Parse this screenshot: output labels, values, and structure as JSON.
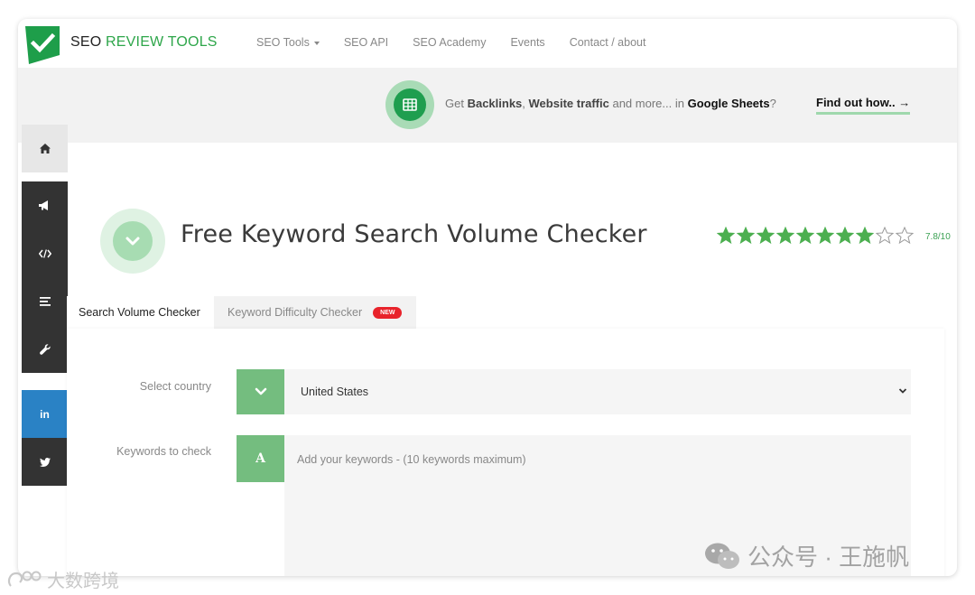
{
  "brand": {
    "name_prefix": "SEO",
    "name_suffix": "REVIEW TOOLS"
  },
  "nav": {
    "items": [
      "SEO Tools",
      "SEO API",
      "SEO Academy",
      "Events",
      "Contact / about"
    ]
  },
  "banner": {
    "text_1": "Get ",
    "bold_1": "Backlinks",
    "text_2": ", ",
    "bold_2": "Website traffic",
    "text_3": " and more... in ",
    "bold_3": "Google Sheets",
    "text_4": "?",
    "cta": "Find out how.. →"
  },
  "sidebar": {
    "icons": [
      "home-icon",
      "megaphone-icon",
      "code-icon",
      "list-icon",
      "wrench-icon",
      "linkedin-icon",
      "twitter-icon"
    ],
    "linkedin_label": "in",
    "colors": {
      "home_bg": "#e7e7e7",
      "dark_bg": "#333333",
      "linkedin_bg": "#2a82c5",
      "twitter_bg": "#333333"
    }
  },
  "page": {
    "title": "Free Keyword Search Volume Checker",
    "rating": {
      "filled_stars": 8,
      "total_stars": 10,
      "label": "7.8/10"
    }
  },
  "tabs": [
    {
      "label": "Search Volume Checker",
      "active": true
    },
    {
      "label": "Keyword Difficulty Checker",
      "active": false,
      "badge": "NEW"
    }
  ],
  "form": {
    "country_label": "Select country",
    "country_value": "United States",
    "keywords_label": "Keywords to check",
    "keywords_addon": "A",
    "keywords_placeholder": "Add your keywords - (10 keywords maximum)"
  },
  "watermarks": {
    "right": "公众号 · 王施帆",
    "left": "大数跨境"
  },
  "colors": {
    "accent_green": "#2ea64a",
    "addon_green": "#74bd7f",
    "badge_red": "#e8232b",
    "star_green": "#4caf50"
  }
}
